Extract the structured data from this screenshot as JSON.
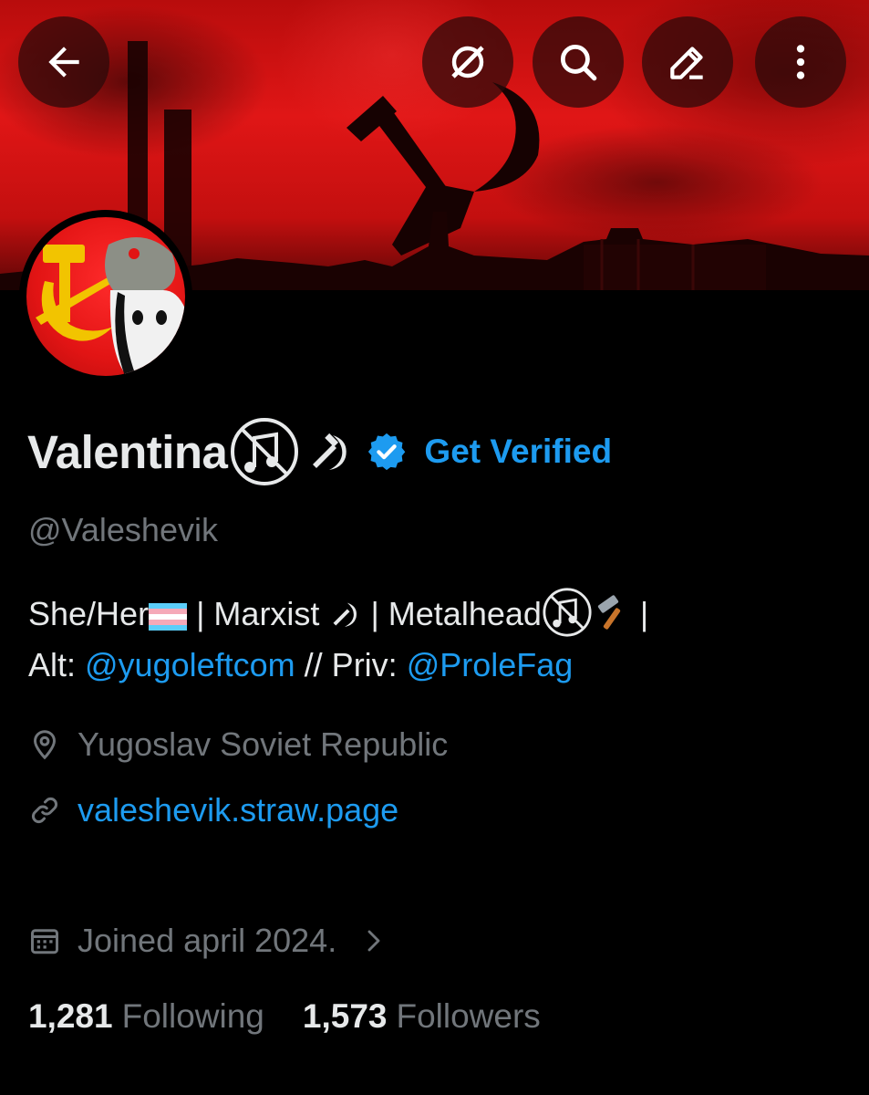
{
  "header": {
    "back_icon": "arrow-left-icon",
    "actions": [
      "grok-icon",
      "search-icon",
      "edit-icon",
      "more-vertical-icon"
    ]
  },
  "profile": {
    "display_name": "Valentina",
    "name_emoji": "🚫🎵☭",
    "verified_icon": "verified-badge-icon",
    "get_verified": "Get Verified",
    "handle": "@Valeshevik",
    "bio": {
      "line1_a": "She/Her",
      "line1_flag": "trans-flag-emoji",
      "line1_b": " | Marxist ",
      "line1_c": " |  Metalhead",
      "line1_d": " |",
      "line2_a": "Alt: ",
      "alt_link": "@yugoleftcom",
      "line2_b": " // Priv: ",
      "priv_link": "@ProleFag"
    },
    "location": "Yugoslav Soviet Republic",
    "website": "valeshevik.straw.page",
    "joined": "Joined april 2024.",
    "following_count": "1,281",
    "following_label": "Following",
    "followers_count": "1,573",
    "followers_label": "Followers"
  },
  "colors": {
    "accent": "#1d9bf0",
    "muted": "#71767b",
    "text": "#e7e9ea",
    "banner_red": "#e01616"
  }
}
